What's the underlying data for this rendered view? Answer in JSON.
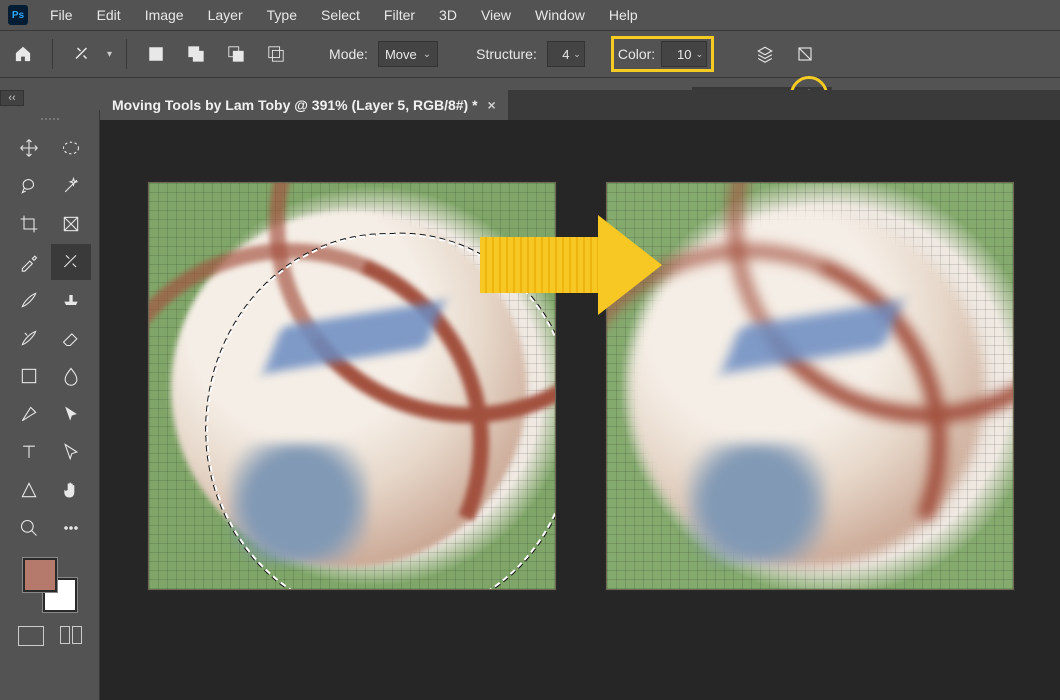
{
  "app_logo_text": "Ps",
  "menu": [
    "File",
    "Edit",
    "Image",
    "Layer",
    "Type",
    "Select",
    "Filter",
    "3D",
    "View",
    "Window",
    "Help"
  ],
  "options": {
    "mode_label": "Mode:",
    "mode_value": "Move",
    "structure_label": "Structure:",
    "structure_value": "4",
    "color_label": "Color:",
    "color_value": "10"
  },
  "document_tab": {
    "title": "Moving Tools by Lam Toby @ 391% (Layer 5, RGB/8#) *"
  },
  "swatches": {
    "foreground": "#b57a6c",
    "background": "#ffffff"
  },
  "highlight": {
    "color_box": true,
    "slider_knob": true
  },
  "chart_data": null
}
